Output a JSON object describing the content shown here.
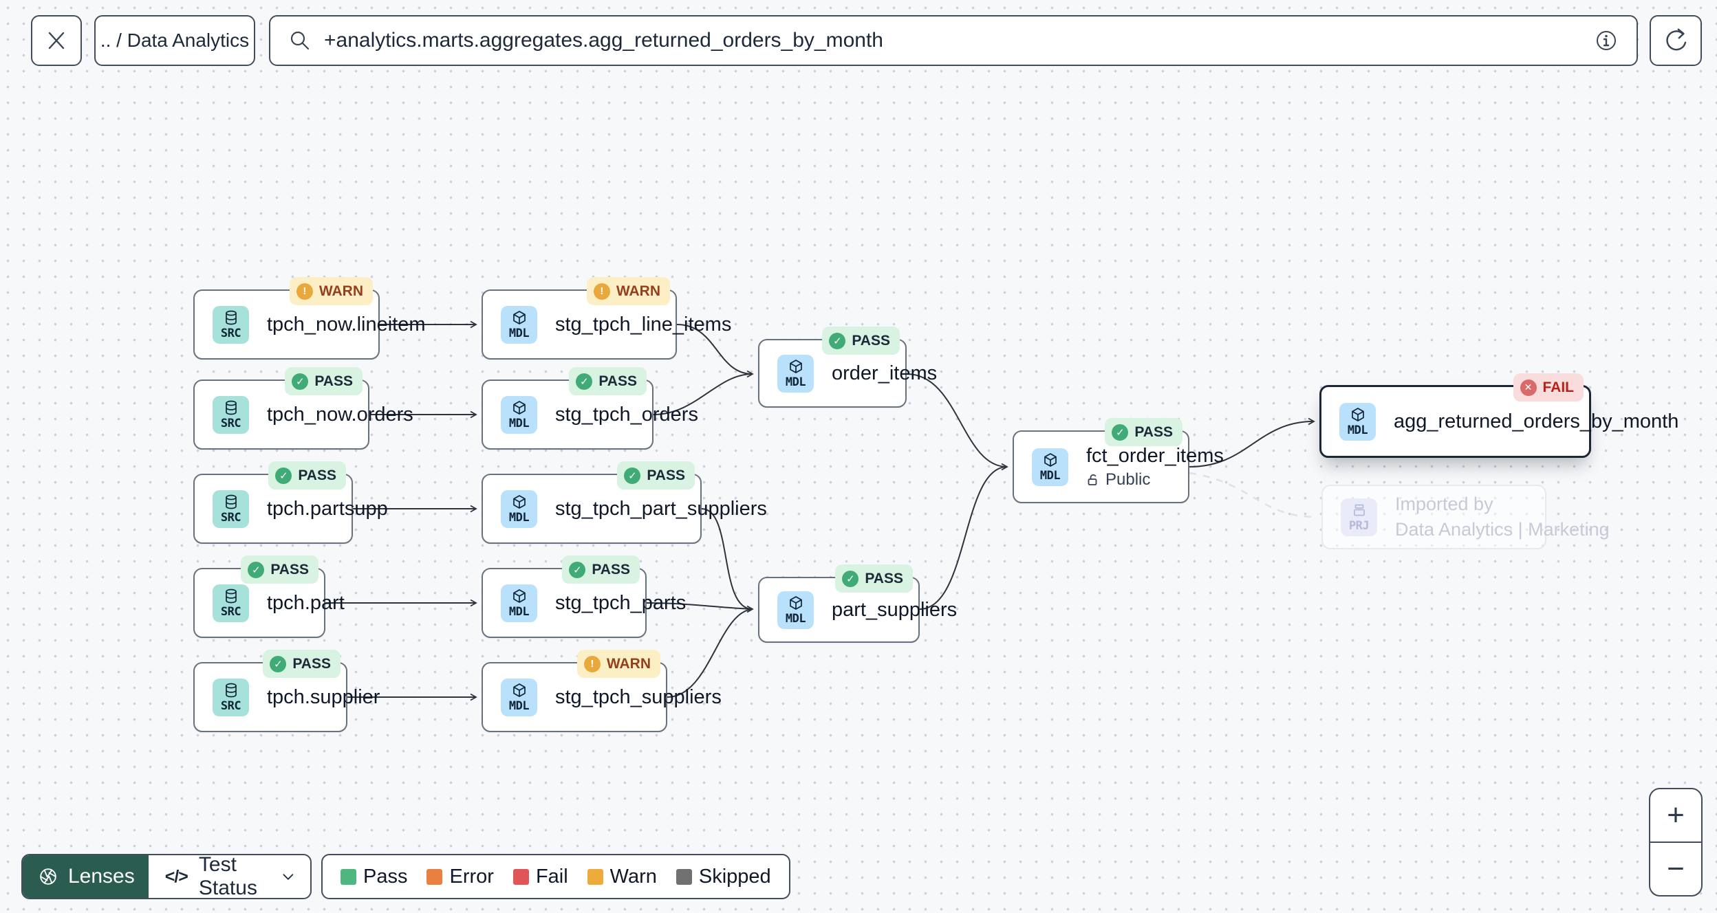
{
  "topbar": {
    "breadcrumb": ".. / Data Analytics",
    "search_value": "+analytics.marts.aggregates.agg_returned_orders_by_month"
  },
  "icons": {
    "close": "✕",
    "search": "magnifier",
    "info": "i",
    "refresh": "clockwise-arrow",
    "lenses": "aperture",
    "test_status_code": "</>",
    "chevron_down": "v",
    "zoom_in": "+",
    "zoom_out": "−",
    "pass_glyph": "✓",
    "warn_glyph": "!",
    "fail_glyph": "✕"
  },
  "graph": {
    "nodes": [
      {
        "kind": "SRC",
        "label": "tpch_now.lineitem",
        "status": "WARN"
      },
      {
        "kind": "MDL",
        "label": "stg_tpch_line_items",
        "status": "WARN"
      },
      {
        "kind": "SRC",
        "label": "tpch_now.orders",
        "status": "PASS"
      },
      {
        "kind": "MDL",
        "label": "stg_tpch_orders",
        "status": "PASS"
      },
      {
        "kind": "SRC",
        "label": "tpch.partsupp",
        "status": "PASS"
      },
      {
        "kind": "MDL",
        "label": "stg_tpch_part_suppliers",
        "status": "PASS"
      },
      {
        "kind": "SRC",
        "label": "tpch.part",
        "status": "PASS"
      },
      {
        "kind": "MDL",
        "label": "stg_tpch_parts",
        "status": "PASS"
      },
      {
        "kind": "SRC",
        "label": "tpch.supplier",
        "status": "PASS"
      },
      {
        "kind": "MDL",
        "label": "stg_tpch_suppliers",
        "status": "WARN"
      },
      {
        "kind": "MDL",
        "label": "order_items",
        "status": "PASS"
      },
      {
        "kind": "MDL",
        "label": "part_suppliers",
        "status": "PASS"
      },
      {
        "kind": "MDL",
        "label": "fct_order_items",
        "status": "PASS",
        "sublabel": "Public"
      },
      {
        "kind": "MDL",
        "label": "agg_returned_orders_by_month",
        "status": "FAIL",
        "selected": true
      },
      {
        "kind": "PRJ",
        "line1": "Imported by",
        "line2": "Data Analytics | Marketing",
        "faded": true
      }
    ]
  },
  "footer": {
    "lenses_label": "Lenses",
    "lens_selector_label": "Test Status",
    "legend": [
      {
        "label": "Pass",
        "color": "#4eb77f"
      },
      {
        "label": "Error",
        "color": "#e8803f"
      },
      {
        "label": "Fail",
        "color": "#e05656"
      },
      {
        "label": "Warn",
        "color": "#edab3c"
      },
      {
        "label": "Skipped",
        "color": "#717171"
      }
    ]
  }
}
